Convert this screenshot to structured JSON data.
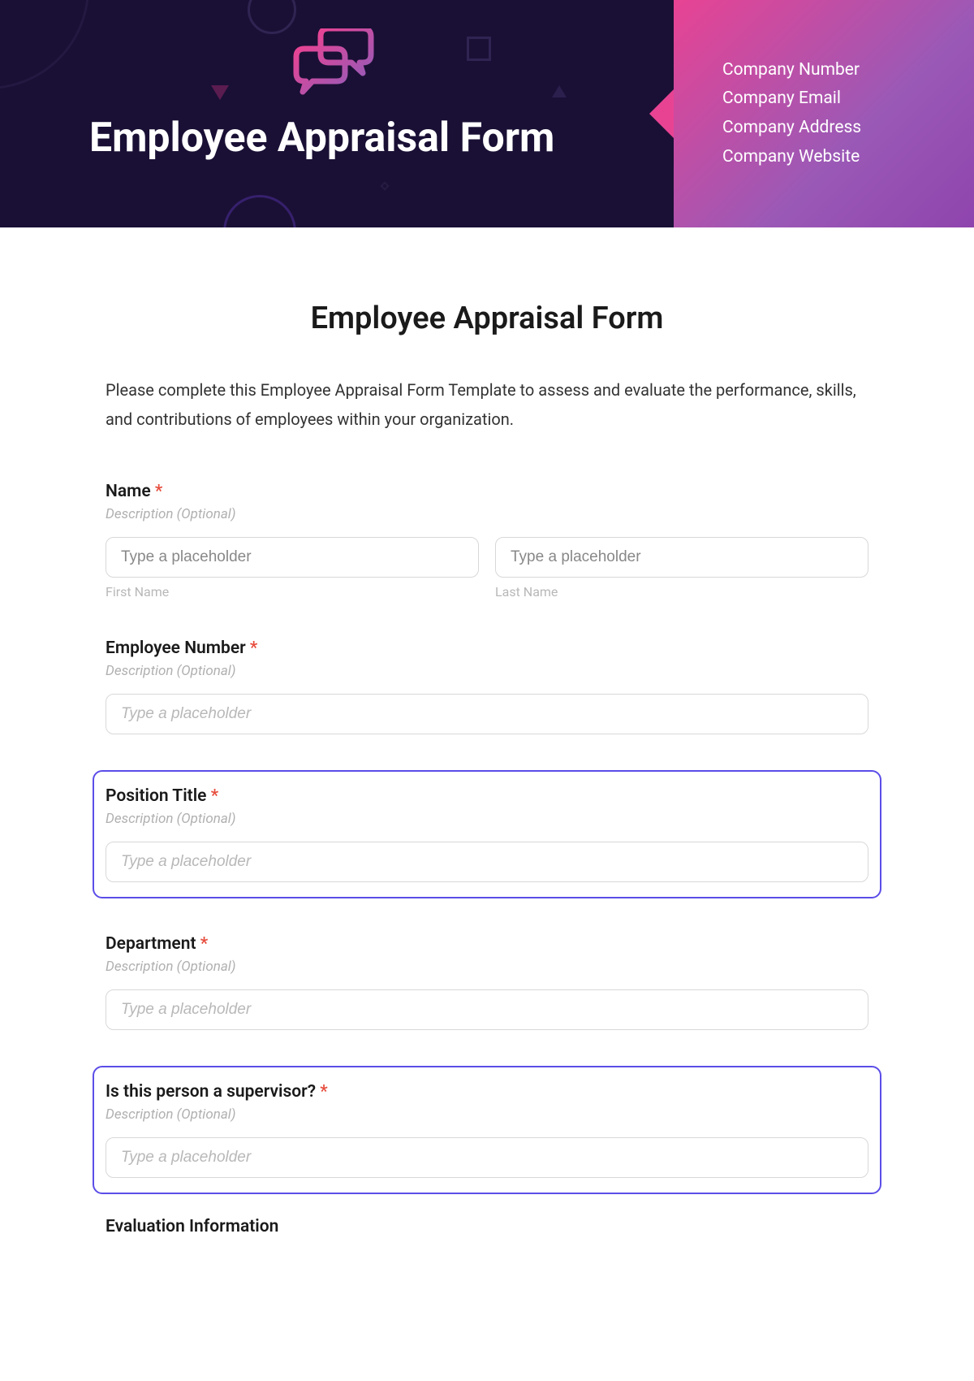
{
  "header": {
    "title": "Employee Appraisal Form",
    "company_lines": [
      "Company Number",
      "Company Email",
      "Company Address",
      "Company Website"
    ]
  },
  "form": {
    "title": "Employee Appraisal Form",
    "description": "Please complete this Employee Appraisal Form Template to assess and evaluate the performance, skills, and contributions of employees within your organization.",
    "desc_placeholder": "Description (Optional)",
    "generic_placeholder": "Type a placeholder",
    "fields": {
      "name": {
        "label": "Name",
        "first_sub": "First Name",
        "last_sub": "Last Name"
      },
      "employee_number": {
        "label": "Employee Number"
      },
      "position_title": {
        "label": "Position Title"
      },
      "department": {
        "label": "Department"
      },
      "supervisor": {
        "label": "Is this person a supervisor?"
      }
    },
    "section_heading": "Evaluation Information",
    "required_marker": "*"
  }
}
